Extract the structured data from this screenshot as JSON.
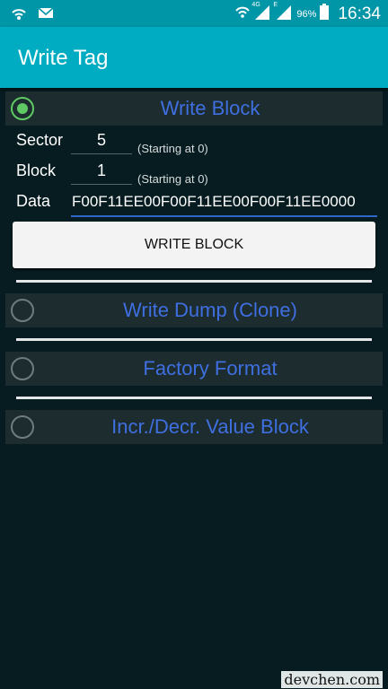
{
  "status_bar": {
    "battery_percent": "96%",
    "time": "16:34",
    "network_labels": [
      "4G",
      "E"
    ],
    "left_icons": [
      "wifi-icon",
      "mail-icon"
    ],
    "right_icons": [
      "wifi-icon",
      "signal-icon",
      "signal-icon",
      "battery-icon"
    ]
  },
  "toolbar": {
    "title": "Write Tag"
  },
  "sections": {
    "write_block": {
      "title": "Write Block",
      "selected": true
    },
    "write_dump": {
      "title": "Write Dump (Clone)",
      "selected": false
    },
    "factory_format": {
      "title": "Factory Format",
      "selected": false
    },
    "value_block": {
      "title": "Incr./Decr. Value Block",
      "selected": false
    }
  },
  "form": {
    "sector_label": "Sector",
    "sector_value": "5",
    "sector_hint": "(Starting at 0)",
    "block_label": "Block",
    "block_value": "1",
    "block_hint": "(Starting at 0)",
    "data_label": "Data",
    "data_value": "F00F11EE00F00F11EE00F00F11EE0000",
    "write_button_label": "WRITE BLOCK"
  },
  "watermark": "devchen.com",
  "colors": {
    "status_bar": "#0096a8",
    "toolbar": "#00acc1",
    "background": "#061c20",
    "section_title": "#3f6fe0",
    "radio_checked": "#5fca64",
    "data_underline": "#2f68c9"
  }
}
